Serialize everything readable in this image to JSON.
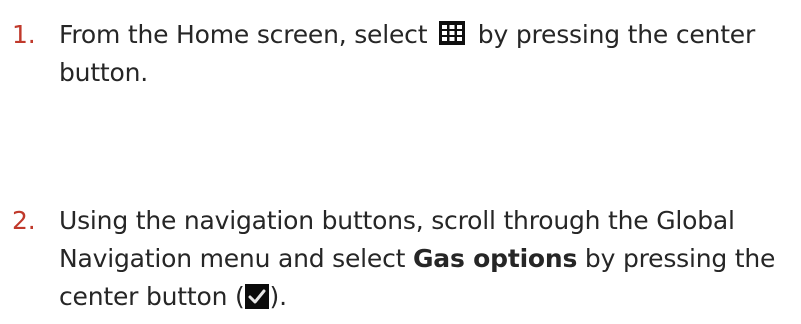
{
  "steps": [
    {
      "number": "1.",
      "line1_before_icon": "From the Home screen, select ",
      "line1_after_icon": " by pressing the center",
      "line2": "button.",
      "icon": "grid-menu-icon"
    },
    {
      "number": "2.",
      "line1": "Using the navigation buttons, scroll through the Global",
      "line2_before_bold": "Navigation menu and select ",
      "line2_bold": "Gas options",
      "line2_after_bold": " by pressing the",
      "line3_before_icon": "center button (",
      "line3_after_icon": ").",
      "icon": "checkmark-icon"
    }
  ],
  "colors": {
    "number": "#c0392b",
    "text": "#262626",
    "icon_bg": "#0f0f0f"
  }
}
